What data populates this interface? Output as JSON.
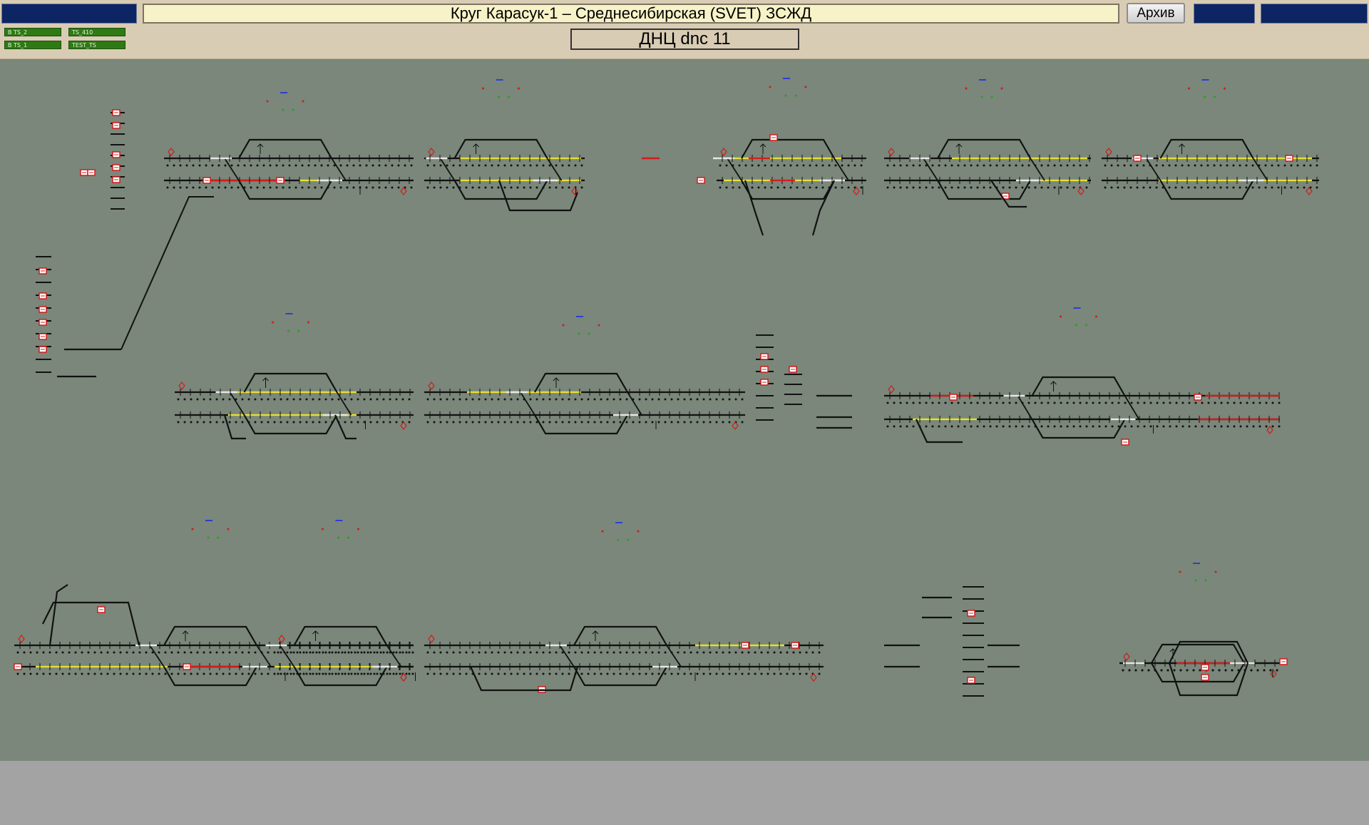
{
  "header": {
    "title": "Круг Карасук-1 – Среднесибирская (SVET) ЗСЖД",
    "archive_label": "Архив",
    "dnc_label": "ДНЦ dnc 11",
    "ts_labels": [
      "B TS_2",
      "TS_410",
      "B TS_1",
      "TEST_TS"
    ]
  },
  "colors": {
    "header_bg": "#d9ccb4",
    "title_bg": "#f7f2c7",
    "navy": "#0d2563",
    "ts_green": "#2f7a14",
    "canvas_bg": "#7a877a",
    "footer_bg": "#a3a3a3",
    "track_black": "#111111",
    "track_yellow": "#e6e03a",
    "track_white": "#e8e8e8",
    "track_red": "#d21c1c",
    "station_blue": "#2a3fd6"
  }
}
